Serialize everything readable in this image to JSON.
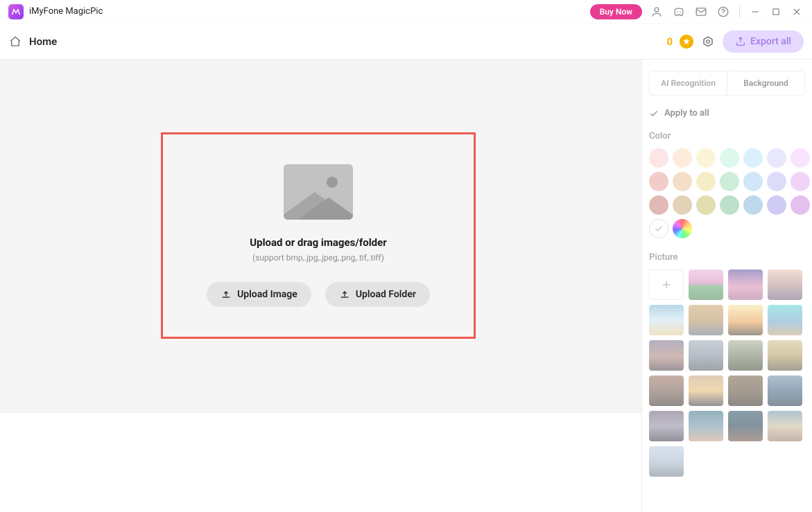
{
  "titlebar": {
    "app_name": "iMyFone MagicPic",
    "buy_now_label": "Buy Now"
  },
  "toolbar": {
    "home_label": "Home",
    "credits": "0",
    "export_label": "Export all"
  },
  "upload": {
    "heading": "Upload or drag images/folder",
    "subtext": "(support bmp,.jpg,.jpeg,.png,.tif,.tiff)",
    "upload_image_label": "Upload Image",
    "upload_folder_label": "Upload Folder"
  },
  "sidepanel": {
    "tab_ai_label": "AI Recognition",
    "tab_bg_label": "Background",
    "apply_all_label": "Apply to all",
    "color_label": "Color",
    "picture_label": "Picture",
    "colors": [
      "#fbcfcf",
      "#fbdcc0",
      "#faecba",
      "#c1f2dc",
      "#bce6fb",
      "#d6d3fb",
      "#f3ccfa",
      "#e8a39a",
      "#ecc39b",
      "#eddf96",
      "#a6dfb9",
      "#aad4f5",
      "#c0bdf5",
      "#e6aff2",
      "#c98179",
      "#cdae7e",
      "#c8c46d",
      "#87c7a0",
      "#89b8de",
      "#a9a0ec",
      "#d08adf"
    ],
    "picture_thumbs": [
      "linear-gradient(180deg,#e9b6d8 0%,#d386bb 45%,#5fa46b 55%,#4a8557 100%)",
      "linear-gradient(180deg,#5e4fa2 0%,#d98bb3 55%,#a96c8e 100%)",
      "linear-gradient(180deg,#e9c4b1 0%,#b48f8c 50%,#6d5f7e 100%)",
      "linear-gradient(180deg,#7fb7d2 0%,#cce4ee 50%,#e1c98f 100%)",
      "linear-gradient(180deg,#c9a46d 0%,#b7905a 50%,#60737f 100%)",
      "linear-gradient(180deg,#f5e29a 0%,#e9a04f 55%,#4a3f30 100%)",
      "linear-gradient(180deg,#5fd2d5 0%,#6fa6c8 55%,#bfa27a 100%)",
      "linear-gradient(180deg,#776e8d 0%,#a77f76 55%,#4a3f47 100%)",
      "linear-gradient(180deg,#9fa7b5 0%,#7e8899 50%,#505a63 100%)",
      "linear-gradient(180deg,#a6b095 0%,#6f7a5f 50%,#3e4633 100%)",
      "linear-gradient(180deg,#cfbf8d 0%,#b19a5f 50%,#5b5038 100%)",
      "linear-gradient(180deg,#9a6f5b 0%,#6f574d 50%,#3a2f2a 100%)",
      "linear-gradient(180deg,#c4a17b 0%,#e4b86f 50%,#3b3b49 100%)",
      "linear-gradient(180deg,#715f47 0%,#5a4b38 50%,#2f2820 100%)",
      "linear-gradient(180deg,#6b89a3 0%,#3f5f82 50%,#213548 100%)",
      "linear-gradient(180deg,#6c5e76 0%,#8b86a1 50%,#3d3747 100%)",
      "linear-gradient(180deg,#3f6f86 0%,#6b93a8 50%,#c79a84 100%)",
      "linear-gradient(180deg,#274e64 0%,#1e3b4c 50%,#6d4e3b 100%)",
      "linear-gradient(180deg,#7095a6 0%,#c8b89c 50%,#9a7666 100%)",
      "linear-gradient(180deg,#b8cddf 0%,#a2b7c9 50%,#6b7a87 100%)"
    ]
  }
}
